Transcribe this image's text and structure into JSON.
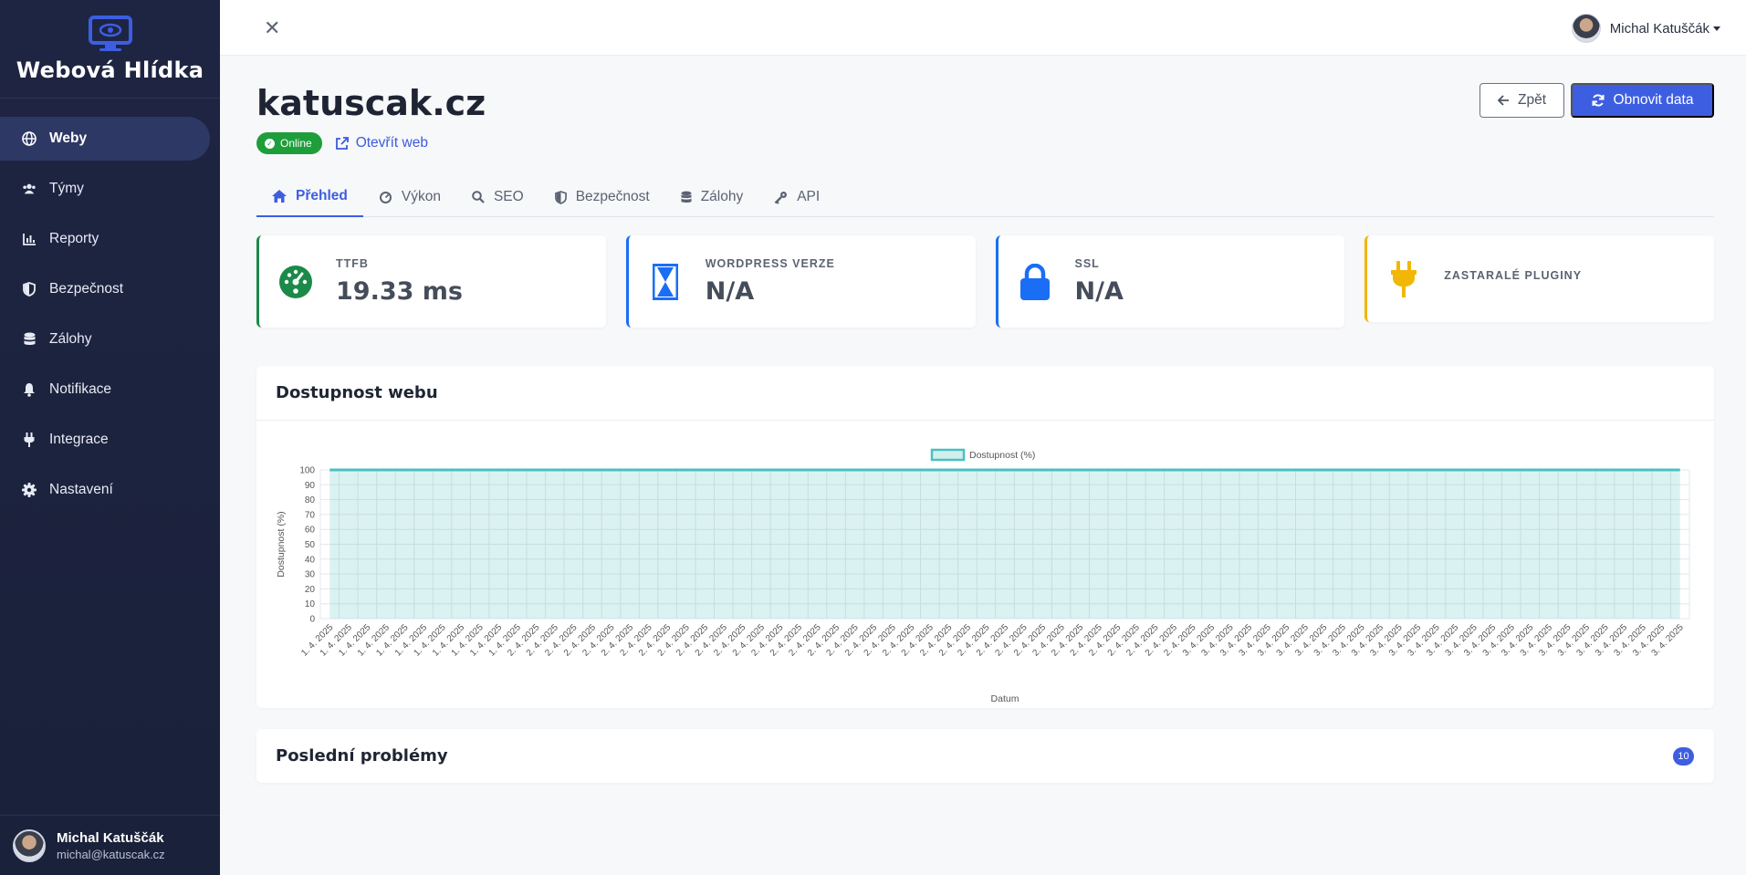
{
  "brand": {
    "name": "Webová Hlídka",
    "icon": "monitor-eye-icon"
  },
  "sidebar": {
    "items": [
      {
        "label": "Weby",
        "icon": "globe-icon",
        "active": true
      },
      {
        "label": "Týmy",
        "icon": "users-icon",
        "active": false
      },
      {
        "label": "Reporty",
        "icon": "chart-bar-icon",
        "active": false
      },
      {
        "label": "Bezpečnost",
        "icon": "shield-icon",
        "active": false
      },
      {
        "label": "Zálohy",
        "icon": "database-icon",
        "active": false
      },
      {
        "label": "Notifikace",
        "icon": "bell-icon",
        "active": false
      },
      {
        "label": "Integrace",
        "icon": "plug-icon",
        "active": false
      },
      {
        "label": "Nastavení",
        "icon": "gear-icon",
        "active": false
      }
    ],
    "user": {
      "name": "Michal Katuščák",
      "email": "michal@katuscak.cz"
    }
  },
  "topbar": {
    "user_name": "Michal Katuščák"
  },
  "site": {
    "title": "katuscak.cz",
    "status": "Online",
    "open_label": "Otevřít web"
  },
  "actions": {
    "back_label": "Zpět",
    "refresh_label": "Obnovit data"
  },
  "tabs": [
    {
      "label": "Přehled",
      "icon": "home-icon",
      "active": true
    },
    {
      "label": "Výkon",
      "icon": "gauge-icon",
      "active": false
    },
    {
      "label": "SEO",
      "icon": "search-icon",
      "active": false
    },
    {
      "label": "Bezpečnost",
      "icon": "shield-icon",
      "active": false
    },
    {
      "label": "Zálohy",
      "icon": "database-icon",
      "active": false
    },
    {
      "label": "API",
      "icon": "key-icon",
      "active": false
    }
  ],
  "stats": [
    {
      "label": "TTFB",
      "value": "19.33 ms",
      "icon": "tachometer-icon",
      "color": "#1b8a48"
    },
    {
      "label": "WORDPRESS VERZE",
      "value": "N/A",
      "icon": "hourglass-icon",
      "color": "#1a6ef5"
    },
    {
      "label": "SSL",
      "value": "N/A",
      "icon": "lock-icon",
      "color": "#1a6ef5"
    },
    {
      "label": "ZASTARALÉ PLUGINY",
      "value": "",
      "icon": "plug-icon",
      "color": "#f2b705"
    }
  ],
  "availability": {
    "title": "Dostupnost webu"
  },
  "issues": {
    "title": "Poslední problémy",
    "count": "10"
  },
  "chart_data": {
    "type": "area",
    "xlabel": "Datum",
    "ylabel": "Dostupnost (%)",
    "ylim": [
      0,
      100
    ],
    "yticks": [
      0,
      10,
      20,
      30,
      40,
      50,
      60,
      70,
      80,
      90,
      100
    ],
    "grid": true,
    "legend": "top-center",
    "color": "#4bc0c0",
    "series": [
      {
        "name": "Dostupnost (%)",
        "value_all": 100
      }
    ],
    "categories_summary": [
      {
        "label": "1. 4. 2025",
        "count": 11
      },
      {
        "label": "2. 4. 2025",
        "count": 36
      },
      {
        "label": "3. 4. 2025",
        "count": 26
      }
    ]
  }
}
